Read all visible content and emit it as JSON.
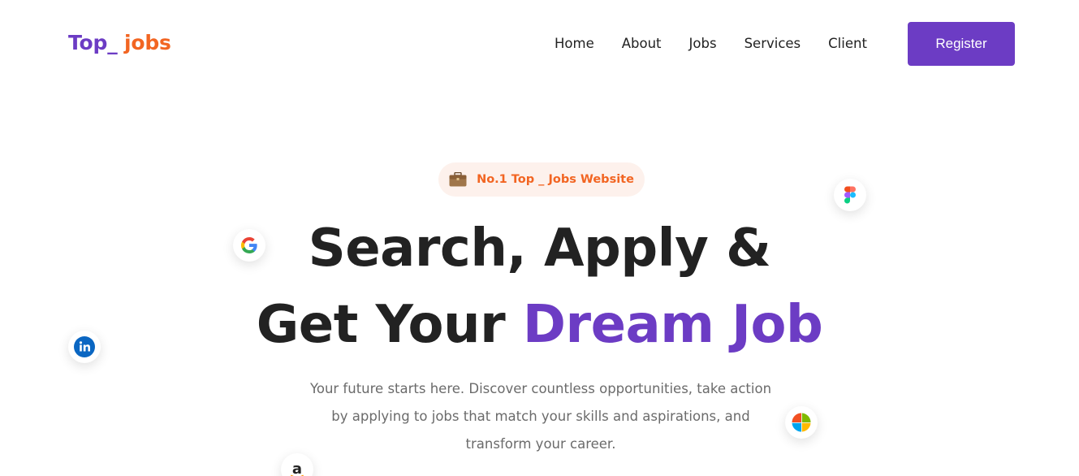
{
  "nav": {
    "logo": {
      "part1": "Top_",
      "part2": " jobs"
    },
    "links": [
      "Home",
      "About",
      "Jobs",
      "Services",
      "Client"
    ],
    "register_label": "Register"
  },
  "hero": {
    "badge": {
      "icon": "briefcase-icon",
      "text": "No.1 Top _ Jobs Website"
    },
    "title_line1": "Search, Apply &",
    "title_line2_prefix": "Get Your ",
    "title_line2_accent": "Dream Job",
    "subtitle_lines": [
      "Your future starts here. Discover countless opportunities, take action",
      "by applying to jobs that match your skills and aspirations, and",
      "transform your career."
    ]
  },
  "floating_icons": [
    "google-icon",
    "figma-icon",
    "linkedin-icon",
    "microsoft-icon",
    "amazon-icon"
  ],
  "colors": {
    "brand_purple": "#6c3cc4",
    "brand_orange": "#f26522",
    "badge_bg": "#fdf1ec",
    "heading": "#222222",
    "body_text": "#6b6b6b"
  }
}
